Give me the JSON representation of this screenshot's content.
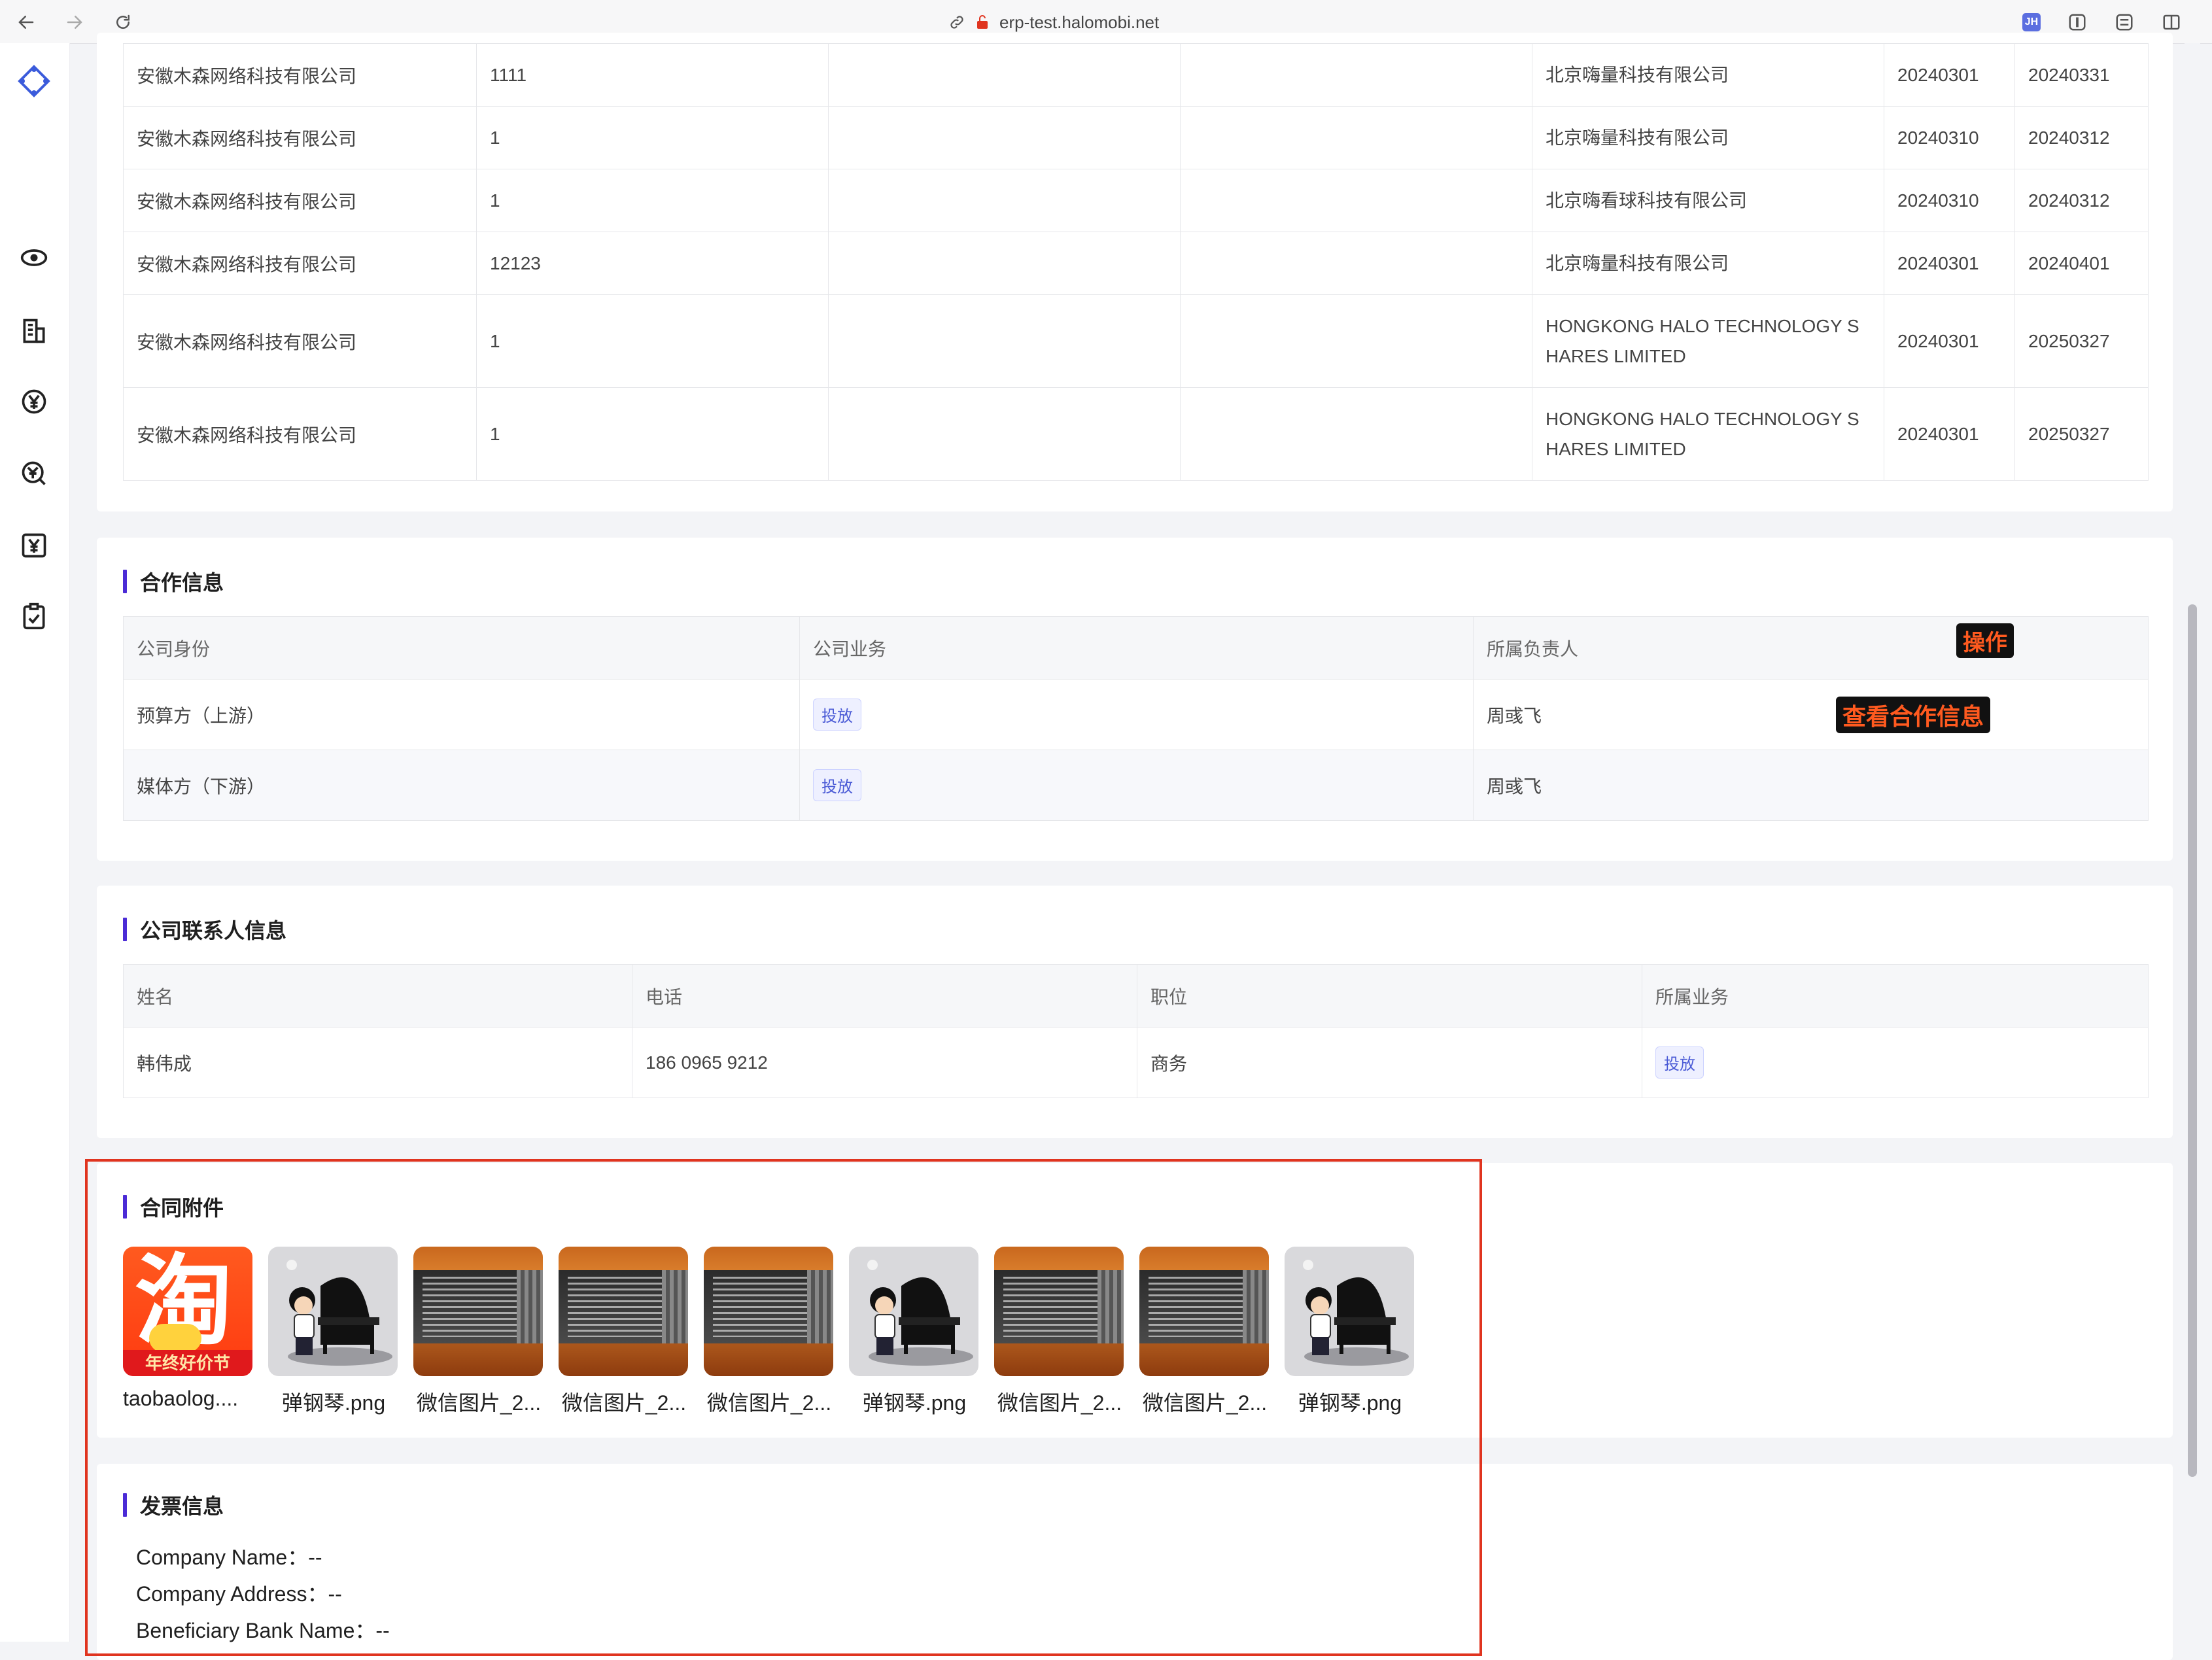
{
  "browser": {
    "url": "erp-test.halomobi.net",
    "extension_badge": "JH"
  },
  "top_table": {
    "rows": [
      {
        "c1": "安徽木森网络科技有限公司",
        "c2": "1111",
        "c3": "",
        "c4": "",
        "c5": "北京嗨量科技有限公司",
        "c6": "20240301",
        "c7": "20240331"
      },
      {
        "c1": "安徽木森网络科技有限公司",
        "c2": "1",
        "c3": "",
        "c4": "",
        "c5": "北京嗨量科技有限公司",
        "c6": "20240310",
        "c7": "20240312"
      },
      {
        "c1": "安徽木森网络科技有限公司",
        "c2": "1",
        "c3": "",
        "c4": "",
        "c5": "北京嗨看球科技有限公司",
        "c6": "20240310",
        "c7": "20240312"
      },
      {
        "c1": "安徽木森网络科技有限公司",
        "c2": "12123",
        "c3": "",
        "c4": "",
        "c5": "北京嗨量科技有限公司",
        "c6": "20240301",
        "c7": "20240401"
      },
      {
        "c1": "安徽木森网络科技有限公司",
        "c2": "1",
        "c3": "",
        "c4": "",
        "c5": "HONGKONG HALO TECHNOLOGY SHARES LIMITED",
        "c6": "20240301",
        "c7": "20250327"
      },
      {
        "c1": "安徽木森网络科技有限公司",
        "c2": "1",
        "c3": "",
        "c4": "",
        "c5": "HONGKONG HALO TECHNOLOGY SHARES LIMITED",
        "c6": "20240301",
        "c7": "20250327"
      }
    ]
  },
  "cooperation": {
    "title": "合作信息",
    "headers": [
      "公司身份",
      "公司业务",
      "所属负责人"
    ],
    "action_label": "操作",
    "view_label": "查看合作信息",
    "rows": [
      {
        "identity": "预算方（上游）",
        "business": "投放",
        "owner": "周彧飞"
      },
      {
        "identity": "媒体方（下游）",
        "business": "投放",
        "owner": "周彧飞"
      }
    ]
  },
  "contacts": {
    "title": "公司联系人信息",
    "headers": [
      "姓名",
      "电话",
      "职位",
      "所属业务"
    ],
    "rows": [
      {
        "name": "韩伟成",
        "phone": "186 0965 9212",
        "position": "商务",
        "business": "投放"
      }
    ]
  },
  "attachments": {
    "title": "合同附件",
    "files": [
      {
        "name": "taobaolog....",
        "kind": "taobao",
        "thumb_text": "淘",
        "band_text": "年终好价节"
      },
      {
        "name": "弹钢琴.png",
        "kind": "piano"
      },
      {
        "name": "微信图片_2...",
        "kind": "photo"
      },
      {
        "name": "微信图片_2...",
        "kind": "photo"
      },
      {
        "name": "微信图片_2...",
        "kind": "photo"
      },
      {
        "name": "弹钢琴.png",
        "kind": "piano"
      },
      {
        "name": "微信图片_2...",
        "kind": "photo"
      },
      {
        "name": "微信图片_2...",
        "kind": "photo"
      },
      {
        "name": "弹钢琴.png",
        "kind": "piano"
      }
    ]
  },
  "invoice": {
    "title": "发票信息",
    "lines": [
      {
        "label": "Company Name：",
        "value": "--"
      },
      {
        "label": "Company Address：",
        "value": "--"
      },
      {
        "label": "Beneficiary Bank Name：",
        "value": "--"
      }
    ]
  },
  "colors": {
    "accent": "#4b2bd6",
    "highlight_box": "#e0341f",
    "tag_text": "#4b5bd6"
  }
}
